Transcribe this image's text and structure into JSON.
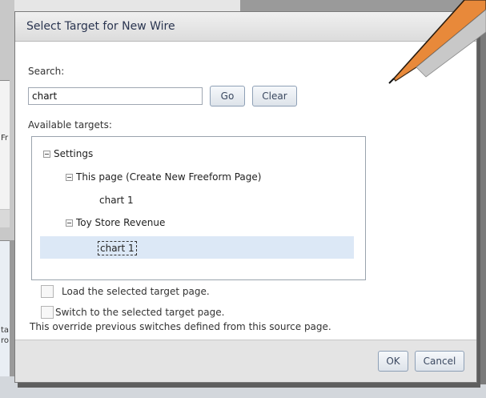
{
  "dialog": {
    "title": "Select Target for New Wire",
    "search_label": "Search:",
    "search_value": "chart",
    "go_label": "Go",
    "clear_label": "Clear",
    "targets_label": "Available targets:",
    "tree": {
      "root": "Settings",
      "group1": "This page (Create New Freeform Page)",
      "group1_child": "chart 1",
      "group2": "Toy Store Revenue",
      "group2_child": "chart 1"
    },
    "load_label": "Load the selected target page.",
    "switch_label": "Switch to the selected target page.",
    "override_note": "This override previous switches defined from this source page.",
    "ok_label": "OK",
    "cancel_label": "Cancel"
  },
  "background": {
    "frag1": "Fr",
    "frag2": "ta",
    "frag3": "ro"
  },
  "colors": {
    "selected_row": "#dce8f6",
    "pencil_orange": "#e8893a"
  }
}
